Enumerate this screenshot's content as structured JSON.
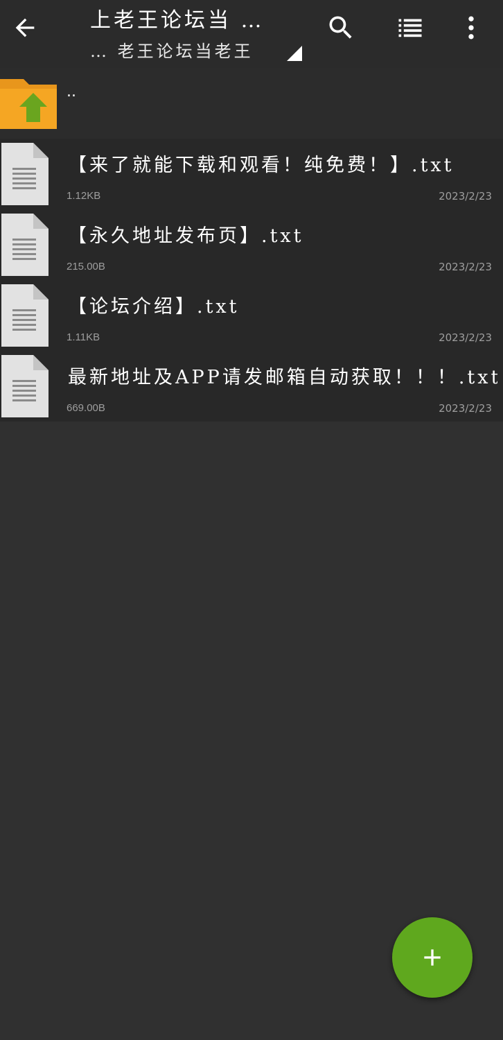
{
  "header": {
    "title_line1": "上老王论坛当 …",
    "title_line2": "… 老王论坛当老王",
    "back_icon": "arrow-left-icon",
    "search_icon": "search-icon",
    "view_icon": "list-view-icon",
    "more_icon": "more-vert-icon"
  },
  "parent": {
    "name": "..",
    "icon": "folder-up-icon"
  },
  "files": [
    {
      "name": "【来了就能下载和观看！纯免费！】.txt",
      "size": "1.12KB",
      "date": "2023/2/23"
    },
    {
      "name": "【永久地址发布页】.txt",
      "size": "215.00B",
      "date": "2023/2/23"
    },
    {
      "name": "【论坛介绍】.txt",
      "size": "1.11KB",
      "date": "2023/2/23"
    },
    {
      "name": "最新地址及APP请发邮箱自动获取！！！.txt",
      "size": "669.00B",
      "date": "2023/2/23"
    }
  ],
  "fab": {
    "icon": "plus-icon"
  },
  "colors": {
    "background": "#303030",
    "appbar": "#2b2b2b",
    "row": "#282828",
    "accent": "#5fa81e",
    "folder": "#f5a623",
    "secondary_text": "#9e9e9e"
  }
}
